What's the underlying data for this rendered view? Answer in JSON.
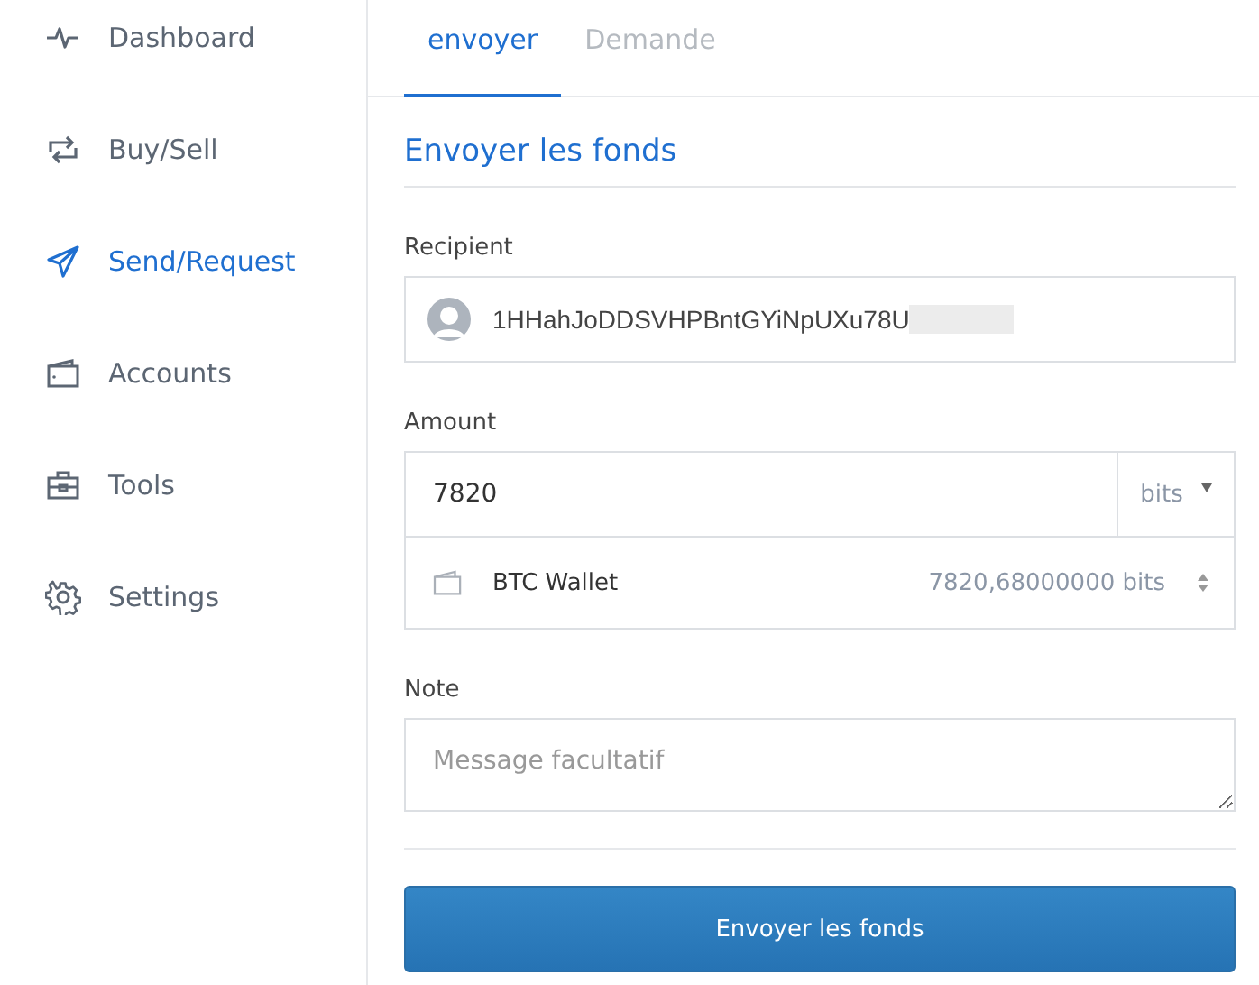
{
  "sidebar": {
    "items": [
      {
        "kind": "pulse",
        "label": "Dashboard",
        "selected": false
      },
      {
        "kind": "swap",
        "label": "Buy/Sell",
        "selected": false
      },
      {
        "kind": "send",
        "label": "Send/Request",
        "selected": true
      },
      {
        "kind": "wallet",
        "label": "Accounts",
        "selected": false
      },
      {
        "kind": "toolbox",
        "label": "Tools",
        "selected": false
      },
      {
        "kind": "gear",
        "label": "Settings",
        "selected": false
      }
    ]
  },
  "tabs": [
    {
      "label": "envoyer",
      "selected": true
    },
    {
      "label": "Demande",
      "selected": false
    }
  ],
  "heading": "Envoyer les fonds",
  "recipient": {
    "label": "Recipient",
    "value": "1HHahJoDDSVHPBntGYiNpUXu78U",
    "redacted": true
  },
  "amount": {
    "label": "Amount",
    "value": "7820",
    "unit": "bits",
    "account": "BTC Wallet",
    "balance": "7820,68000000 bits"
  },
  "note": {
    "label": "Note",
    "placeholder": "Message facultatif"
  },
  "submit": "Envoyer les fonds"
}
